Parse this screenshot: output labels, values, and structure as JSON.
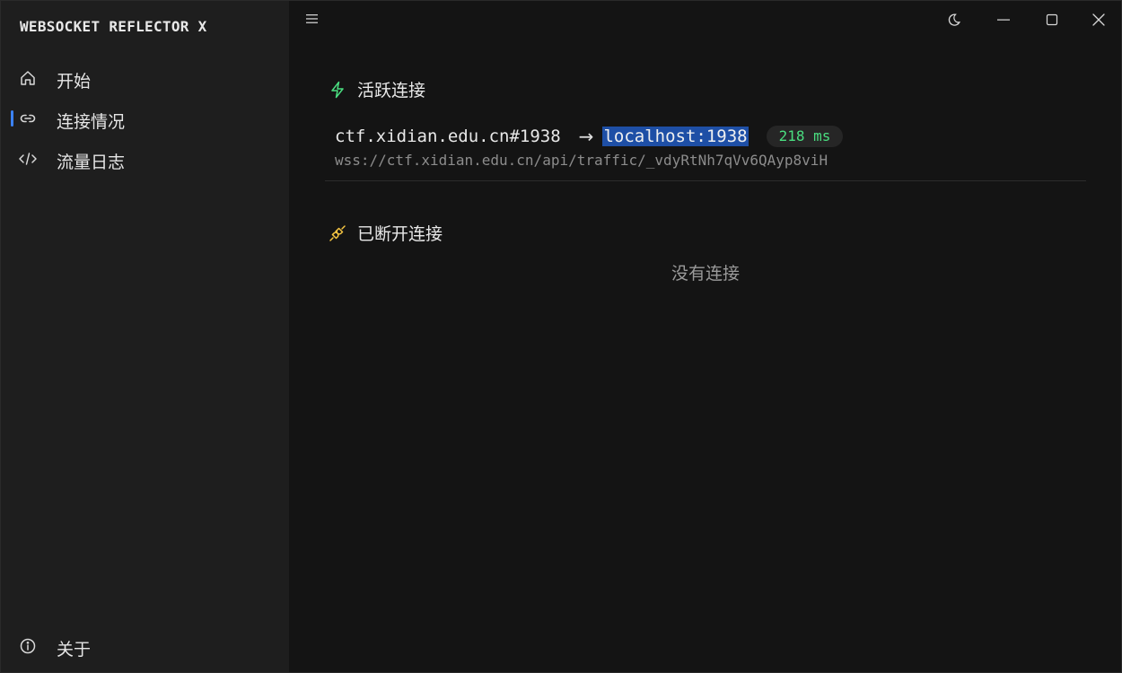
{
  "app": {
    "title": "WEBSOCKET REFLECTOR X"
  },
  "sidebar": {
    "items": [
      {
        "label": "开始",
        "icon": "home-icon",
        "active": false
      },
      {
        "label": "连接情况",
        "icon": "link-icon",
        "active": true
      },
      {
        "label": "流量日志",
        "icon": "code-icon",
        "active": false
      }
    ],
    "footer_item": {
      "label": "关于",
      "icon": "info-icon"
    }
  },
  "window_controls": {
    "theme": "moon-icon",
    "minimize": "minimize-icon",
    "maximize": "maximize-icon",
    "close": "close-icon"
  },
  "active_section": {
    "title": "活跃连接",
    "icon": "lightning-icon",
    "icon_color": "#4ade80",
    "connections": [
      {
        "source": "ctf.xidian.edu.cn#1938",
        "arrow": "→",
        "target": "localhost:1938",
        "latency": "218 ms",
        "url": "wss://ctf.xidian.edu.cn/api/traffic/_vdyRtNh7qVv6QAyp8viH"
      }
    ]
  },
  "disconnected_section": {
    "title": "已断开连接",
    "icon": "unplug-icon",
    "icon_color": "#f5c542",
    "empty_text": "没有连接"
  },
  "colors": {
    "accent": "#3b82f6",
    "latency": "#4ade80",
    "selection": "#1e4fa6",
    "sidebar_bg": "#1e1e1e",
    "main_bg": "#141414"
  }
}
